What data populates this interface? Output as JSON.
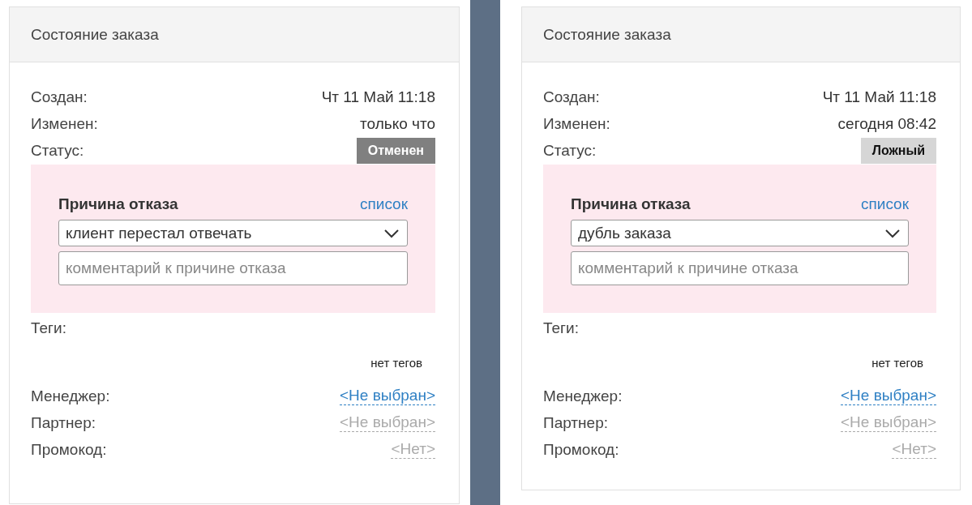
{
  "cards": [
    {
      "title": "Состояние заказа",
      "rows": [
        {
          "label": "Создан:",
          "value": "Чт 11 Май 11:18"
        },
        {
          "label": "Изменен:",
          "value": "только что"
        }
      ],
      "status": {
        "label": "Статус:",
        "value": "Отменен",
        "kind": "cancelled"
      },
      "reason": {
        "title": "Причина отказа",
        "link": "список",
        "selected": "клиент перестал отвечать",
        "placeholder": "комментарий к причине отказа"
      },
      "tags": {
        "label": "Теги:",
        "empty": "нет тегов"
      },
      "people": [
        {
          "label": "Менеджер:",
          "value": "<Не выбран>",
          "disabled": false
        },
        {
          "label": "Партнер:",
          "value": "<Не выбран>",
          "disabled": true
        },
        {
          "label": "Промокод:",
          "value": "<Нет>",
          "disabled": true
        }
      ]
    },
    {
      "title": "Состояние заказа",
      "rows": [
        {
          "label": "Создан:",
          "value": "Чт 11 Май 11:18"
        },
        {
          "label": "Изменен:",
          "value": "сегодня 08:42"
        }
      ],
      "status": {
        "label": "Статус:",
        "value": "Ложный",
        "kind": "false"
      },
      "reason": {
        "title": "Причина отказа",
        "link": "список",
        "selected": "дубль заказа",
        "placeholder": "комментарий к причине отказа"
      },
      "tags": {
        "label": "Теги:",
        "empty": "нет тегов"
      },
      "people": [
        {
          "label": "Менеджер:",
          "value": "<Не выбран>",
          "disabled": false
        },
        {
          "label": "Партнер:",
          "value": "<Не выбран>",
          "disabled": true
        },
        {
          "label": "Промокод:",
          "value": "<Нет>",
          "disabled": true
        }
      ]
    }
  ]
}
